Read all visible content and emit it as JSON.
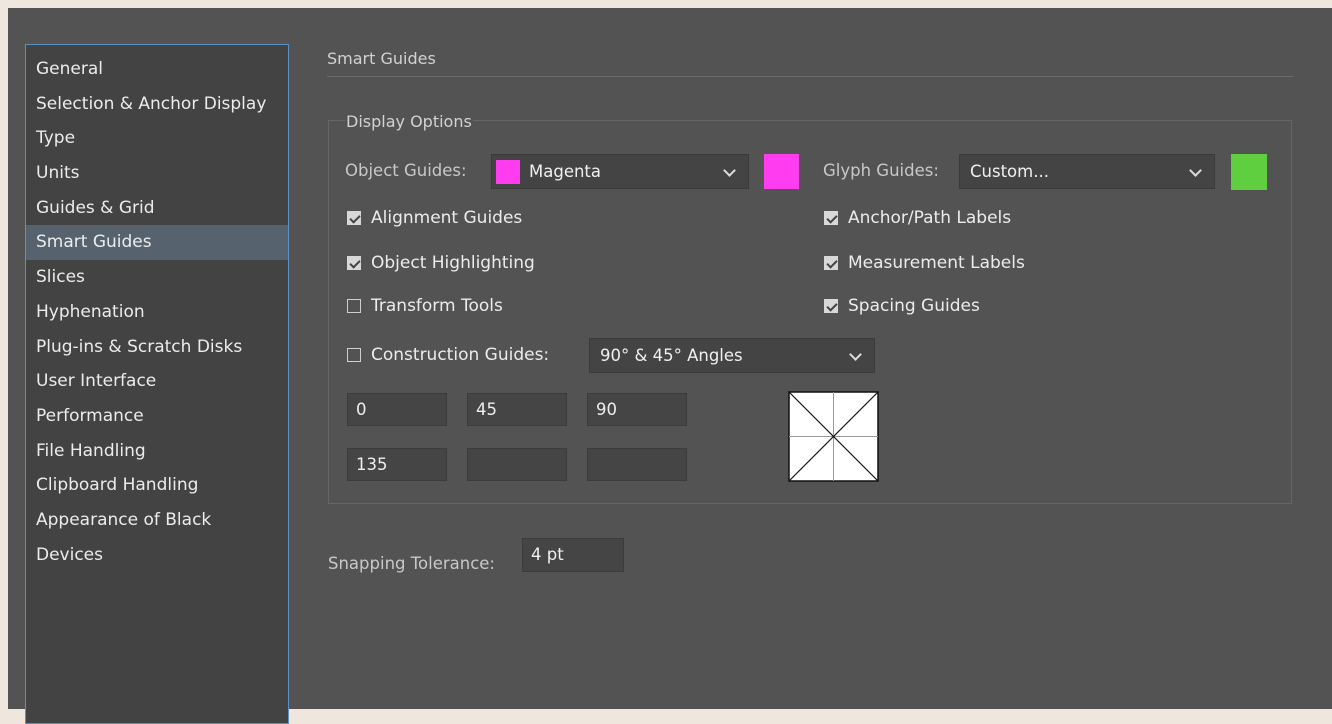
{
  "sidebar": {
    "items": [
      {
        "label": "General"
      },
      {
        "label": "Selection & Anchor Display"
      },
      {
        "label": "Type"
      },
      {
        "label": "Units"
      },
      {
        "label": "Guides & Grid"
      },
      {
        "label": "Smart Guides",
        "selected": true
      },
      {
        "label": "Slices"
      },
      {
        "label": "Hyphenation"
      },
      {
        "label": "Plug-ins & Scratch Disks"
      },
      {
        "label": "User Interface"
      },
      {
        "label": "Performance"
      },
      {
        "label": "File Handling"
      },
      {
        "label": "Clipboard Handling"
      },
      {
        "label": "Appearance of Black"
      },
      {
        "label": "Devices"
      }
    ]
  },
  "panel": {
    "title": "Smart Guides",
    "display_options": {
      "title": "Display Options",
      "object_guides": {
        "label": "Object Guides:",
        "value": "Magenta",
        "color": "#ff3cf0"
      },
      "glyph_guides": {
        "label": "Glyph Guides:",
        "value": "Custom...",
        "color": "#5fce3f"
      },
      "checks": {
        "alignment_guides": {
          "label": "Alignment Guides",
          "checked": true
        },
        "object_highlighting": {
          "label": "Object Highlighting",
          "checked": true
        },
        "transform_tools": {
          "label": "Transform Tools",
          "checked": false
        },
        "anchor_path_labels": {
          "label": "Anchor/Path Labels",
          "checked": true
        },
        "measurement_labels": {
          "label": "Measurement Labels",
          "checked": true
        },
        "spacing_guides": {
          "label": "Spacing Guides",
          "checked": true
        },
        "construction_guides": {
          "label": "Construction Guides:",
          "checked": false
        }
      },
      "construction_angles": {
        "value": "90° & 45° Angles"
      },
      "angle_fields": [
        "0",
        "45",
        "90",
        "135",
        "",
        ""
      ]
    },
    "snapping": {
      "label": "Snapping Tolerance:",
      "value": "4 pt"
    }
  },
  "colors": {
    "accent_border": "#5b8fc7",
    "selected_bg": "#56636f",
    "panel_bg": "#535353"
  }
}
